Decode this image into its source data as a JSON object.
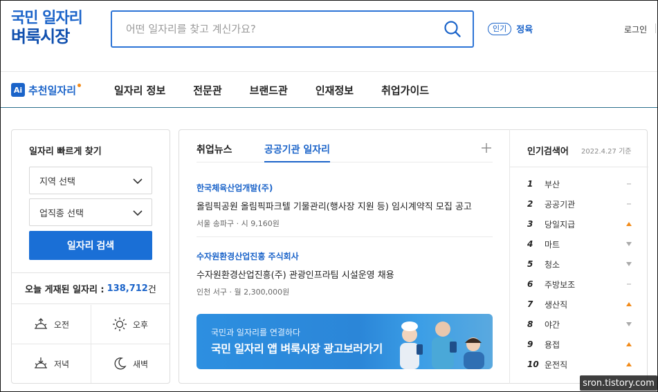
{
  "header": {
    "logo_line1": "국민 일자리",
    "logo_line2": "벼룩시장",
    "search_placeholder": "어떤 일자리를 찾고 계신가요?",
    "popular_pill": "인기",
    "popular_keyword": "정육",
    "login": "로그인"
  },
  "nav": {
    "ai_badge": "Ai",
    "ai_label": "추천일자리",
    "items": [
      "일자리 정보",
      "전문관",
      "브랜드관",
      "인재정보",
      "취업가이드"
    ]
  },
  "quick": {
    "title": "일자리 빠르게 찾기",
    "region_select": "지역 선택",
    "job_select": "업직종 선택",
    "search_button": "일자리 검색",
    "today_label": "오늘 게재된 일자리 :",
    "today_count": "138,712",
    "today_unit": "건",
    "times": [
      "오전",
      "오후",
      "저녁",
      "새벽"
    ]
  },
  "news": {
    "tabs": [
      "취업뉴스",
      "공공기관 일자리"
    ],
    "active_tab": 1,
    "jobs": [
      {
        "company": "한국체육산업개발(주)",
        "title": "올림픽공원 올림픽파크텔 기물관리(행사장 지원 등) 임시계약직 모집 공고",
        "meta": "서울 송파구 · 시 9,160원"
      },
      {
        "company": "수자원환경산업진흥 주식회사",
        "title": "수자원환경산업진흥(주) 관광인프라팀 시설운영 채용",
        "meta": "인천 서구 · 월 2,300,000원"
      }
    ],
    "banner_sub": "국민과 일자리를 연결하다",
    "banner_main": "국민 일자리 앱 벼룩시장 광고보러가기"
  },
  "popular": {
    "title": "인기검색어",
    "date": "2022.4.27 기준",
    "items": [
      {
        "rank": "1",
        "word": "부산",
        "trend": "same"
      },
      {
        "rank": "2",
        "word": "공공기관",
        "trend": "same"
      },
      {
        "rank": "3",
        "word": "당일지급",
        "trend": "up"
      },
      {
        "rank": "4",
        "word": "마트",
        "trend": "down"
      },
      {
        "rank": "5",
        "word": "청소",
        "trend": "down"
      },
      {
        "rank": "6",
        "word": "주방보조",
        "trend": "same"
      },
      {
        "rank": "7",
        "word": "생산직",
        "trend": "up"
      },
      {
        "rank": "8",
        "word": "야간",
        "trend": "down"
      },
      {
        "rank": "9",
        "word": "용접",
        "trend": "up"
      },
      {
        "rank": "10",
        "word": "운전직",
        "trend": "up"
      }
    ]
  },
  "colors": {
    "brand": "#1a63c9",
    "up": "#f28b1a",
    "down": "#aaaaaa",
    "same": "#bbbbbb"
  },
  "watermark": "sron.tistory.com"
}
